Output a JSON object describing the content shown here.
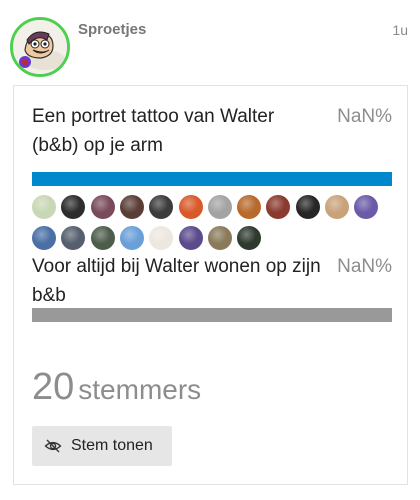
{
  "post": {
    "username": "Sproetjes",
    "time": "1u"
  },
  "poll": {
    "options": [
      {
        "text": "Een portret tattoo van Walter (b&b) op je arm",
        "percent": "NaN%",
        "bar_color": "#0088cc",
        "bar_fill": 1.0
      },
      {
        "text": "Voor altijd bij Walter wonen op zijn b&b",
        "percent": "NaN%",
        "bar_color": "#999999",
        "bar_fill": 1.0
      }
    ],
    "voter_avatar_colors": [
      "#c8d7b5",
      "#2d2d2d",
      "#7a4b5a",
      "#5a3e36",
      "#3c3c3c",
      "#d85a2a",
      "#a3a3a3",
      "#b86a2c",
      "#8a3a2e",
      "#262626",
      "#c9a27a",
      "#6a5aa8",
      "#4a6fa5",
      "#555f6e",
      "#4e5d4b",
      "#6a9fd8",
      "#ece7df",
      "#5b4a8c",
      "#8a7a5a",
      "#2f3a2f"
    ],
    "total_count": "20",
    "total_label": "stemmers",
    "show_votes_label": "Stem tonen"
  },
  "icons": {
    "show_votes": "eye-off-icon"
  }
}
